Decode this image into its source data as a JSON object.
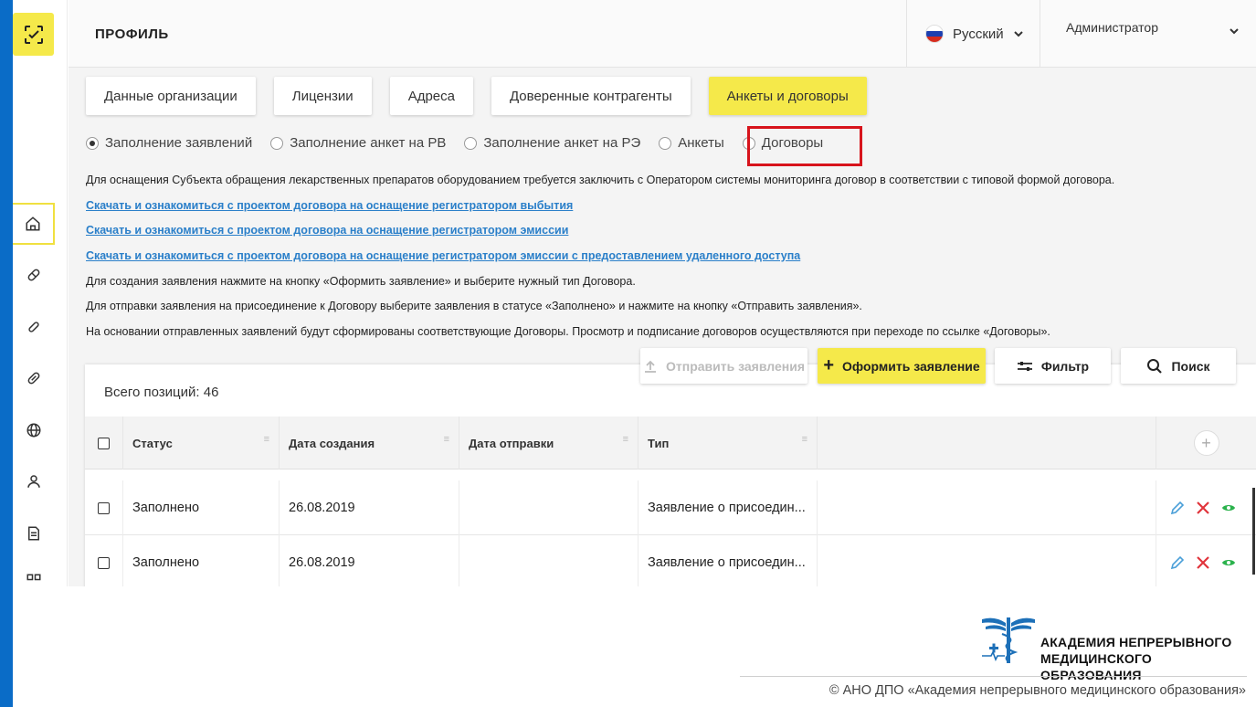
{
  "header": {
    "title": "ПРОФИЛЬ",
    "language": "Русский",
    "user": "Администратор"
  },
  "tabs": [
    {
      "label": "Данные организации",
      "active": false
    },
    {
      "label": "Лицензии",
      "active": false
    },
    {
      "label": "Адреса",
      "active": false
    },
    {
      "label": "Доверенные контрагенты",
      "active": false
    },
    {
      "label": "Анкеты и договоры",
      "active": true
    }
  ],
  "radios": [
    {
      "label": "Заполнение заявлений",
      "checked": true
    },
    {
      "label": "Заполнение анкет на РВ",
      "checked": false
    },
    {
      "label": "Заполнение анкет на РЭ",
      "checked": false
    },
    {
      "label": "Анкеты",
      "checked": false
    },
    {
      "label": "Договоры",
      "checked": false
    }
  ],
  "info": {
    "intro": "Для оснащения Субъекта обращения лекарственных препаратов оборудованием требуется заключить с Оператором системы мониторинга договор в соответствии с типовой формой договора.",
    "link1": "Скачать и ознакомиться с проектом договора на оснащение регистратором выбытия",
    "link2": "Скачать и ознакомиться с проектом договора на оснащение регистратором эмиссии",
    "link3": "Скачать и ознакомиться с проектом договора на оснащение регистратором эмиссии с предоставлением удаленного доступа",
    "line1": "Для создания заявления нажмите на кнопку «Оформить заявление» и выберите нужный тип Договора.",
    "line2": "Для отправки заявления на присоединение к Договору выберите заявления в статусе «Заполнено» и нажмите на кнопку «Отправить заявления».",
    "line3": "На основании отправленных заявлений будут сформированы соответствующие Договоры. Просмотр и подписание договоров осуществляются при переходе по ссылке «Договоры»."
  },
  "actions": {
    "send": "Отправить заявления",
    "create": "Оформить заявление",
    "filter": "Фильтр",
    "search": "Поиск"
  },
  "table": {
    "total": "Всего позиций: 46",
    "columns": [
      "Статус",
      "Дата создания",
      "Дата отправки",
      "Тип"
    ],
    "rows": [
      {
        "status": "Заполнено",
        "created": "26.08.2019",
        "sent": "",
        "type": "Заявление о присоедин..."
      },
      {
        "status": "Заполнено",
        "created": "26.08.2019",
        "sent": "",
        "type": "Заявление о присоедин..."
      }
    ]
  },
  "footer": {
    "brand_line1": "АКАДЕМИЯ НЕПРЕРЫВНОГО",
    "brand_line2": "МЕДИЦИНСКОГО ОБРАЗОВАНИЯ",
    "copyright": "© АНО ДПО «Академия непрерывного медицинского образования»"
  },
  "colors": {
    "accent_yellow": "#f5e94a",
    "link_blue": "#2a7fc9",
    "highlight_red": "#d7141c",
    "edit_blue": "#4a9fd8",
    "delete_red": "#e0343b",
    "view_green": "#2bb24c",
    "brand_blue": "#0a6cc7"
  }
}
